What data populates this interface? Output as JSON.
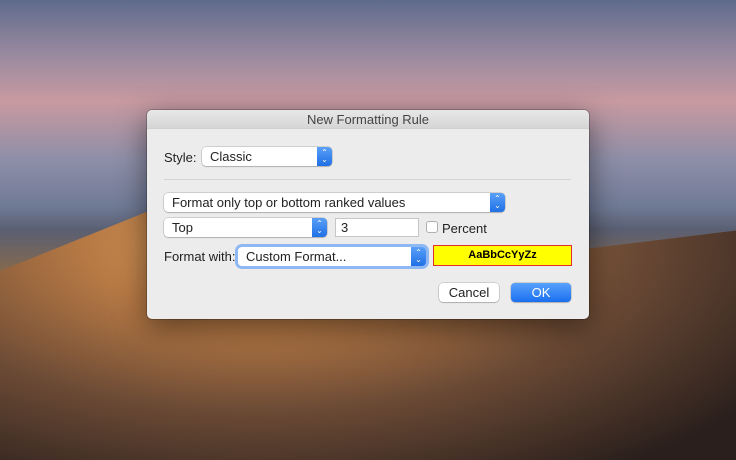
{
  "dialog": {
    "title": "New Formatting Rule"
  },
  "style": {
    "label": "Style:",
    "value": "Classic"
  },
  "rule_type": {
    "value": "Format only top or bottom ranked values"
  },
  "rank": {
    "direction": "Top",
    "count": "3",
    "percent_label": "Percent",
    "percent_checked": false
  },
  "format_with": {
    "label": "Format with:",
    "value": "Custom Format...",
    "preview_text": "AaBbCcYyZz",
    "preview_bg": "#ffff00",
    "preview_border": "#e03030"
  },
  "buttons": {
    "cancel": "Cancel",
    "ok": "OK"
  },
  "colors": {
    "accent": "#1a6ff0"
  }
}
